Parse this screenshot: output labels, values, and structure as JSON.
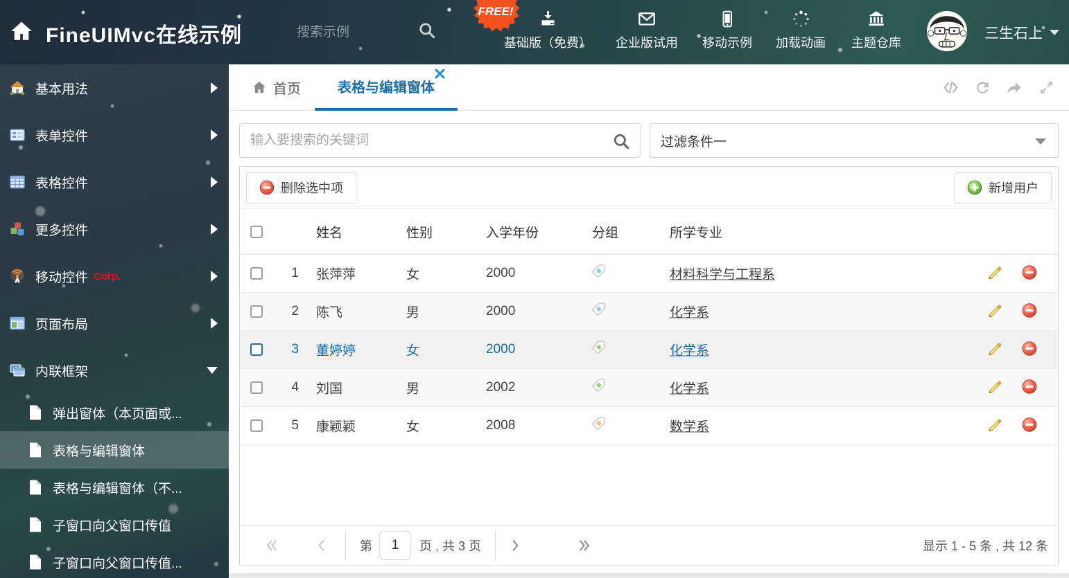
{
  "header": {
    "title": "FineUIMvc在线示例",
    "search_placeholder": "搜索示例",
    "free_badge": "FREE!",
    "actions": [
      {
        "label": "基础版（免费）",
        "icon": "download-icon"
      },
      {
        "label": "企业版试用",
        "icon": "envelope-icon"
      },
      {
        "label": "移动示例",
        "icon": "mobile-icon"
      },
      {
        "label": "加载动画",
        "icon": "spinner-icon"
      },
      {
        "label": "主题仓库",
        "icon": "bank-icon"
      }
    ],
    "username": "三生石上"
  },
  "sidebar": {
    "items": [
      {
        "label": "基本用法",
        "icon": "house-icon"
      },
      {
        "label": "表单控件",
        "icon": "form-icon"
      },
      {
        "label": "表格控件",
        "icon": "table-icon"
      },
      {
        "label": "更多控件",
        "icon": "cubes-icon"
      },
      {
        "label": "移动控件",
        "badge": "Corp.",
        "icon": "beacon-icon"
      },
      {
        "label": "页面布局",
        "icon": "layout-icon"
      },
      {
        "label": "内联框架",
        "icon": "frames-icon",
        "expanded": true
      }
    ],
    "subitems": [
      {
        "label": "弹出窗体（本页面或..."
      },
      {
        "label": "表格与编辑窗体",
        "selected": true
      },
      {
        "label": "表格与编辑窗体（不..."
      },
      {
        "label": "子窗口向父窗口传值"
      },
      {
        "label": "子窗口向父窗口传值..."
      }
    ]
  },
  "tabs": {
    "home_label": "首页",
    "active_label": "表格与编辑窗体"
  },
  "filters": {
    "search_placeholder": "输入要搜索的关键词",
    "dropdown_value": "过滤条件一"
  },
  "toolbar": {
    "delete_label": "删除选中项",
    "add_label": "新增用户"
  },
  "table": {
    "headers": {
      "name": "姓名",
      "gender": "性别",
      "year": "入学年份",
      "group": "分组",
      "major": "所学专业"
    },
    "rows": [
      {
        "num": "1",
        "name": "张萍萍",
        "gender": "女",
        "year": "2000",
        "tag_color": "#8ecdf0",
        "major": "材料科学与工程系",
        "selected": false
      },
      {
        "num": "2",
        "name": "陈飞",
        "gender": "男",
        "year": "2000",
        "tag_color": "#8ecdf0",
        "major": "化学系",
        "selected": false
      },
      {
        "num": "3",
        "name": "董婷婷",
        "gender": "女",
        "year": "2000",
        "tag_color": "#9ccf70",
        "major": "化学系",
        "selected": true
      },
      {
        "num": "4",
        "name": "刘国",
        "gender": "男",
        "year": "2002",
        "tag_color": "#9ccf70",
        "major": "化学系",
        "selected": false
      },
      {
        "num": "5",
        "name": "康颖颖",
        "gender": "女",
        "year": "2008",
        "tag_color": "#f7bd7f",
        "major": "数学系",
        "selected": false
      }
    ]
  },
  "pagination": {
    "prefix": "第",
    "page_value": "1",
    "suffix": "页 , 共 3 页",
    "summary": "显示 1 - 5 条 , 共 12 条"
  },
  "colors": {
    "accent_blue": "#1d6fa5",
    "free_badge_orange": "#f4511e",
    "corp_red": "#e8101c",
    "selected_row_text": "#1b6ca8",
    "tag_blue": "#8ecdf0",
    "tag_green": "#9ccf70",
    "tag_orange": "#f7bd7f"
  },
  "icons": {
    "header": [
      "home-icon",
      "search-icon",
      "download-icon",
      "envelope-icon",
      "mobile-icon",
      "spinner-icon",
      "bank-icon",
      "caret-down-icon"
    ],
    "tabbar": [
      "home-icon",
      "close-icon",
      "code-icon",
      "refresh-icon",
      "share-icon",
      "expand-icon"
    ],
    "table": [
      "checkbox",
      "tag-icon",
      "pencil-icon",
      "minus-circle-icon",
      "plus-circle-icon"
    ],
    "pager": [
      "first-page-icon",
      "prev-page-icon",
      "next-page-icon",
      "last-page-icon"
    ]
  }
}
